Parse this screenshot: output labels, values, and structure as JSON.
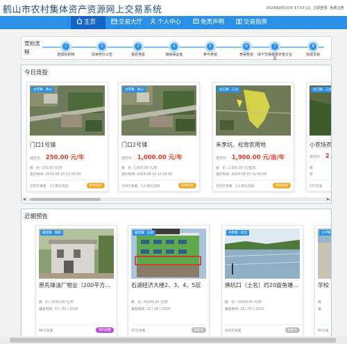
{
  "header": {
    "title": "鹤山市农村集体资产资源网上交易系统",
    "datetime": "2024年8月10日 17:07:13",
    "login": "立即登录",
    "register": "免费注册"
  },
  "nav": {
    "items": [
      {
        "label": "主页",
        "icon": "home-icon",
        "active": true
      },
      {
        "label": "交易大厅",
        "icon": "hall-icon",
        "active": false
      },
      {
        "label": "个人中心",
        "icon": "user-icon",
        "active": false
      },
      {
        "label": "免责声明",
        "icon": "notice-icon",
        "active": false
      },
      {
        "label": "交易指南",
        "icon": "guide-icon",
        "active": false
      }
    ]
  },
  "flow": {
    "label": "竞拍流程",
    "steps": [
      {
        "num": "1",
        "label": "选择标的物"
      },
      {
        "num": "2",
        "label": "阅读竞价公告"
      },
      {
        "num": "3",
        "label": "报名竞投"
      },
      {
        "num": "4",
        "label": "缴纳保证金"
      },
      {
        "num": "5",
        "label": "参与竞拍"
      },
      {
        "num": "6",
        "label": "竞得竞拍"
      },
      {
        "num": "7",
        "label": "线下交易缴费并签订合同"
      },
      {
        "num": "8",
        "label": "完成交易"
      }
    ]
  },
  "today": {
    "title": "今日竞投",
    "cards": [
      {
        "tag": "古劳镇 · 茶山",
        "name": "门口1号铺",
        "price_label": "成交价:",
        "price": "250.00 元/年",
        "base_label": "底　价:",
        "base": "250.00 元/年",
        "time_label": "竞价时间:",
        "time": "2024-08-20 11:00:00",
        "views": "208次查看",
        "bidders": "1人参与竞投",
        "badge": "即将竞投"
      },
      {
        "tag": "古劳镇 · 茶山",
        "name": "门口2号铺",
        "price_label": "成交价:",
        "price": "1,000.00 元/年",
        "base_label": "底　价:",
        "base": "1,000.00 元/年",
        "time_label": "竞价时间:",
        "time": "2024-08-20 12:00:00",
        "views": "149次查看",
        "bidders": "1人参与竞投",
        "badge": "即将竞投"
      },
      {
        "tag": "龙口镇 · 三洲",
        "name": "禾李坑、松背农用地",
        "price_label": "成交价:",
        "price": "1,900.00 元/亩/年",
        "base_label": "底　价:",
        "base": "1,900.00 元/亩/年",
        "time_label": "竞价时间:",
        "time": "2024-08-20 11:00:00",
        "views": "150次查看",
        "bidders": "1人参与竞投",
        "badge": "即将竞投"
      },
      {
        "tag": "龙口镇 · 三洲",
        "name": "小农场农",
        "price_label": "成交价:",
        "price": "2",
        "base_label": "底",
        "base": "",
        "time_label": "竞",
        "time": "",
        "views": "152次查",
        "bidders": "",
        "badge": ""
      }
    ]
  },
  "upcoming": {
    "title": "近期预告",
    "cards": [
      {
        "tag": "雅瑶镇 · 隔朗",
        "name": "原先锋油厂物业（200平方...",
        "base_label": "底　价:",
        "base": "1500.00 元/月",
        "time_label": "报名时间:",
        "time": "15 | 05 | 2024",
        "views": "86次查看",
        "badge": "预约提醒"
      },
      {
        "tag": "雅瑶镇 · 石湖",
        "name": "石湖经济大楼2、3、4、5层",
        "base_label": "底　价:",
        "base": "30240.00 元/年",
        "time_label": "报名时间:",
        "time": "22 | 08 | 2024",
        "views": "92次查看",
        "badge": "报名中"
      },
      {
        "tag": "共和镇 · 桩坑",
        "name": "佛坑口（土名）约20亩鱼塘...",
        "base_label": "底　价:",
        "base": "15000.00 元/年",
        "time_label": "报名时间:",
        "time": "18 | 05 | 2024",
        "views": "160次查看",
        "badge": "报名中"
      },
      {
        "tag": "沙坪镇",
        "name": "学校",
        "base_label": "底",
        "base": "",
        "time_label": "报",
        "time": "",
        "views": "65次查",
        "badge": ""
      }
    ]
  },
  "colors": {
    "brand": "#2b8fe6",
    "nav_active": "#1565c8",
    "price": "#e23a20",
    "badge_orange": "#f5a623",
    "badge_purple": "#b84ddb",
    "badge_gray": "#bbbbbb"
  }
}
